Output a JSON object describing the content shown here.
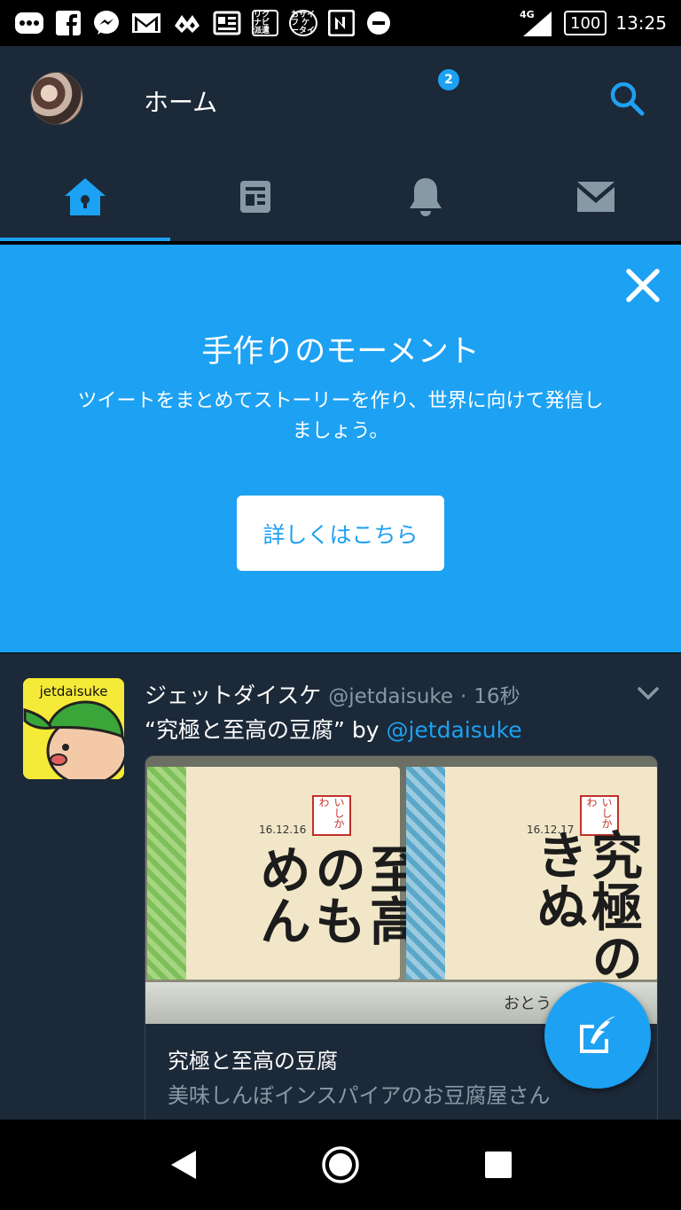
{
  "status_bar": {
    "time": "13:25",
    "battery": "100",
    "network": "4G",
    "icons": [
      "more-icon",
      "facebook-icon",
      "messenger-icon",
      "gmail-icon",
      "app-icon",
      "news-icon",
      "rikunabi-icon",
      "app-icon-2",
      "nfc-icon",
      "do-not-disturb-icon",
      "signal-icon",
      "battery-icon"
    ],
    "app_labels": [
      "リクナビ 派遣",
      "おサイフ ケータイ"
    ]
  },
  "header": {
    "title": "ホーム",
    "tabs": [
      {
        "name": "home",
        "icon": "home-icon",
        "active": true
      },
      {
        "name": "moments",
        "icon": "moments-icon",
        "active": false
      },
      {
        "name": "notifications",
        "icon": "bell-icon",
        "active": false,
        "badge": "2"
      },
      {
        "name": "messages",
        "icon": "mail-icon",
        "active": false
      }
    ],
    "accent": "#1da1f2",
    "background": "#1c2938"
  },
  "promo": {
    "title": "手作りのモーメント",
    "body": "ツイートをまとめてストーリーを作り、世界に向けて発信しましょう。",
    "button": "詳しくはこちら",
    "background": "#1da1f2"
  },
  "tweet": {
    "avatar_text": "jetdaisuke",
    "name": "ジェットダイスケ",
    "handle": "@jetdaisuke",
    "separator": "·",
    "time": "16秒",
    "text_prefix": "“究極と至高の豆腐” by ",
    "text_link": "@jetdaisuke",
    "card": {
      "title": "究極と至高の豆腐",
      "description": "美味しんぼインスパイアのお豆腐屋さん",
      "image": {
        "left_label": "至高のもめん",
        "left_date": "16.12.16",
        "right_label": "究極のきぬ",
        "right_date": "16.12.17",
        "brand": "いしかわ",
        "shelf_tag": "おとう"
      }
    }
  },
  "nav": {
    "back": "back-icon",
    "home": "home-button-icon",
    "recents": "recents-icon"
  }
}
